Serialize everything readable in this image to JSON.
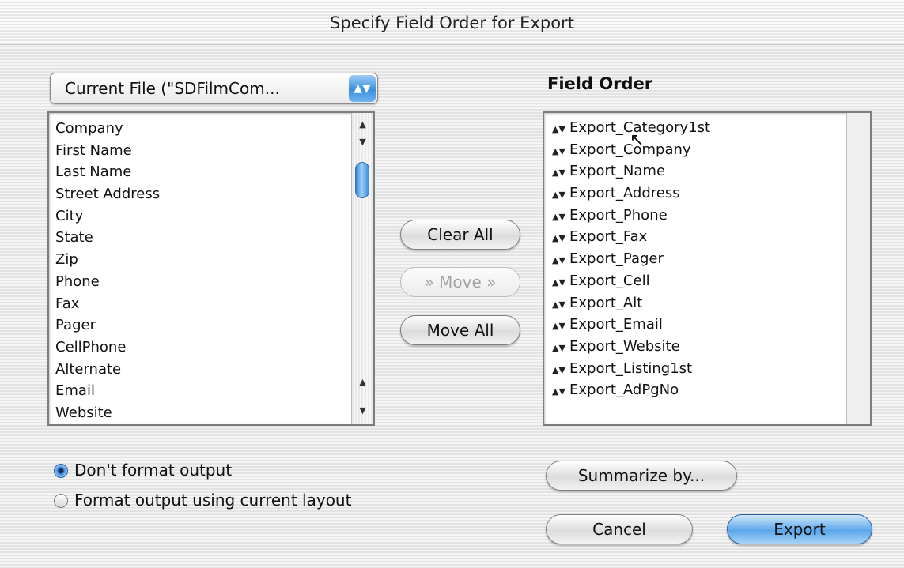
{
  "window": {
    "title": "Specify Field Order for Export"
  },
  "source_popup": {
    "label": "Current File (\"SDFilmCom..."
  },
  "left_list": {
    "items": [
      "Company",
      "First Name",
      "Last Name",
      "Street Address",
      "City",
      "State",
      "Zip",
      "Phone",
      "Fax",
      "Pager",
      "CellPhone",
      "Alternate",
      "Email",
      "Website"
    ]
  },
  "field_order": {
    "heading": "Field Order",
    "items": [
      "Export_Category1st",
      "Export_Company",
      "Export_Name",
      "Export_Address",
      "Export_Phone",
      "Export_Fax",
      "Export_Pager",
      "Export_Cell",
      "Export_Alt",
      "Export_Email",
      "Export_Website",
      "Export_Listing1st",
      "Export_AdPgNo"
    ]
  },
  "buttons": {
    "clear_all": "Clear All",
    "move": "» Move »",
    "move_all": "Move All",
    "summarize": "Summarize by...",
    "cancel": "Cancel",
    "export": "Export"
  },
  "options": {
    "dont_format": "Don't format output",
    "format_layout": "Format output using current layout",
    "selected": "dont_format"
  },
  "icons": {
    "popup": "up-down-arrows-icon",
    "grip": "drag-handle-icon",
    "scroll_up": "scroll-up-arrow-icon",
    "scroll_down": "scroll-down-arrow-icon",
    "cursor": "mouse-pointer-icon"
  }
}
